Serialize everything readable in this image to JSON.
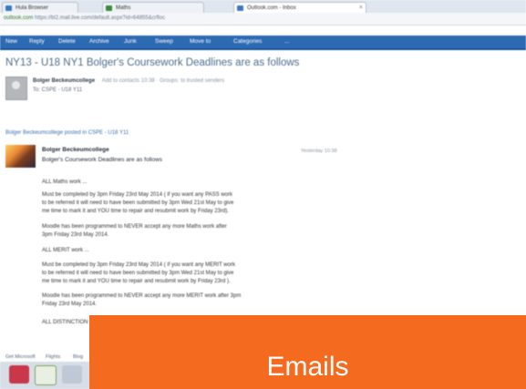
{
  "browser": {
    "tabs": [
      {
        "label": "Hula Browser"
      },
      {
        "label": "Maths"
      },
      {
        "label": "Outlook.com - Inbox"
      }
    ],
    "address": "outlook.com",
    "address_rest": "https://bl2.mail.live.com/default.aspx?id=64855&crfloc"
  },
  "toolbar": {
    "items": [
      "New",
      "Reply",
      "Delete",
      "Archive",
      "Junk",
      "Sweep",
      "Move to",
      "Categories",
      "..."
    ]
  },
  "email": {
    "subject": "NY13 - U18 NY1 Bolger's Coursework Deadlines are as follows",
    "sender_name": "Bolger Beckeumcollege",
    "sender_meta": "Add to contacts 10:38 · Groups: to trusted senders",
    "recipient": "To: CSPE - U18 Y11",
    "posted_line": "Bolger Beckeumcollege posted in CSPE - U18 Y11",
    "message": {
      "author": "Bolger Beckeumcollege",
      "time": "Yesterday 10:38",
      "headline": "Bolger's Coursework Deadlines are as follows",
      "paragraphs": [
        "ALL Maths work ...",
        "Must be completed by 3pm Friday 23rd May 2014 ( if you want any PASS work",
        "to be referred it will need to have been submitted by 3pm Wed 21st May to give",
        "me time to mark it and YOU time to repair and resubmit work by Friday 23rd).",
        "Moodle has been programmed to NEVER accept any more Maths work after",
        "3pm Friday 23rd May 2014.",
        "ALL MERIT work ...",
        "Must be completed by 3pm Friday 23rd May 2014 ( if you want any MERIT work",
        "to be referred it will need to have been submitted by 3pm Wed 21st May to give",
        "me time to mark it and YOU time to repair and resubmit work by Friday 23rd ).",
        "Moodle has been programmed to NEVER accept any more MERIT work after 3pm",
        "Friday 23rd May 2014.",
        "ALL DISTINCTION work ..."
      ]
    }
  },
  "statusbar": {
    "items": [
      "Get Microsoft",
      "Flights",
      "Blog"
    ]
  },
  "banner": {
    "label": "Emails",
    "color": "#f46a1f"
  },
  "colors": {
    "toolbar": "#2d6ab4",
    "subject": "#4e6b8b"
  }
}
